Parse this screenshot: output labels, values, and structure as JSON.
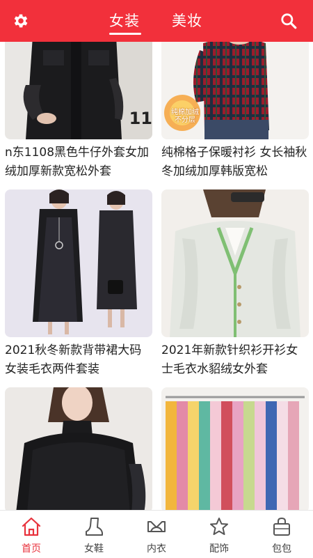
{
  "header": {
    "tabs": [
      {
        "label": "女装",
        "active": true
      },
      {
        "label": "美妆",
        "active": false
      }
    ],
    "left_icon": "gear-icon",
    "right_icon": "search-icon",
    "background": "#f2303b"
  },
  "products": [
    {
      "title": "n东1108黑色牛仔外套女加绒加厚新款宽松外套",
      "image_overlay_text": "11"
    },
    {
      "title": "纯棉格子保暖衬衫 女长袖秋冬加绒加厚韩版宽松",
      "badge": {
        "line1": "纯棉加绒",
        "line2": "不分层"
      }
    },
    {
      "title": "2021秋冬新款背带裙大码女装毛衣两件套装"
    },
    {
      "title": "2021年新款针织衫开衫女士毛衣水貂绒女外套"
    },
    {
      "title": ""
    },
    {
      "title": ""
    }
  ],
  "bottom_nav": {
    "items": [
      {
        "label": "首页",
        "icon": "home-icon",
        "active": true
      },
      {
        "label": "女鞋",
        "icon": "boot-icon",
        "active": false
      },
      {
        "label": "内衣",
        "icon": "bra-icon",
        "active": false
      },
      {
        "label": "配饰",
        "icon": "star-icon",
        "active": false
      },
      {
        "label": "包包",
        "icon": "bag-icon",
        "active": false
      }
    ],
    "active_color": "#e8323c"
  }
}
